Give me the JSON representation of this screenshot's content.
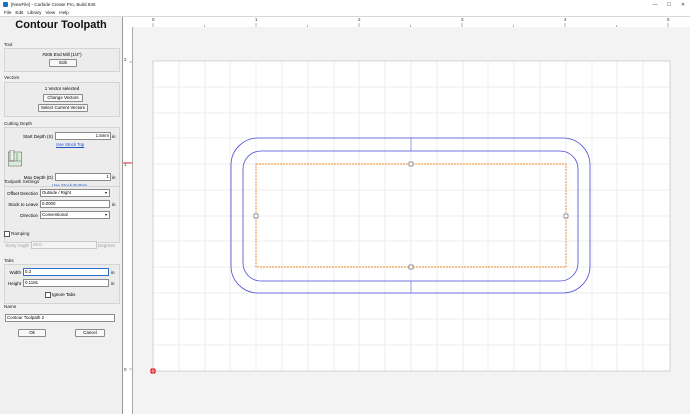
{
  "window": {
    "title": "[NewFile] - Carbide Create Pro, Build 845",
    "minimize": "—",
    "maximize": "☐",
    "close": "✕"
  },
  "menu": [
    "File",
    "Edit",
    "Library",
    "View",
    "Help"
  ],
  "panel": {
    "title": "Contour Toolpath",
    "tool": {
      "section": "Tool",
      "name": "#205 End Mill (1/4\")",
      "edit": "Edit"
    },
    "vectors": {
      "section": "Vectors",
      "status": "1 Vector selected",
      "change": "Change Vectors",
      "select_current": "Select Current Vectors"
    },
    "cutting_depth": {
      "section": "Cutting Depth",
      "start_label": "Start Depth (S)",
      "start_value": "1.5mm",
      "start_unit": "in",
      "use_stock_top": "Use Stock Top",
      "max_label": "Max Depth (D)",
      "max_value": "1",
      "max_unit": "in",
      "use_stock_bottom": "Use Stock Bottom"
    },
    "settings": {
      "section": "Toolpath Settings",
      "offset_label": "Offset Direction",
      "offset_value": "Outside / Right",
      "stock_label": "Stock to Leave",
      "stock_value": "0.0000",
      "stock_unit": "in",
      "direction_label": "Direction",
      "direction_value": "Conventional"
    },
    "ramping": {
      "label": "Ramping",
      "entry_label": "Entry Angle",
      "entry_value": "20.0",
      "entry_unit": "Degrees"
    },
    "tabs": {
      "section": "Tabs",
      "width_label": "Width",
      "width_value": "0.3",
      "width_unit": "in",
      "height_label": "Height",
      "height_value": "0.1181",
      "height_unit": "in",
      "ignore_label": "Ignore Tabs"
    },
    "name": {
      "section": "Name",
      "value": "Contour Toolpath 2"
    },
    "ok": "Ok",
    "cancel": "Cancel"
  },
  "ruler": {
    "top_labels": [
      "0",
      "1",
      "2",
      "3",
      "4",
      "5"
    ],
    "left_labels": [
      "2",
      "1",
      "0"
    ]
  },
  "colors": {
    "vector": "#3a3ad0",
    "selected_vector": "#f08a24",
    "grid": "#d4d4d4",
    "origin": "#e02020"
  }
}
